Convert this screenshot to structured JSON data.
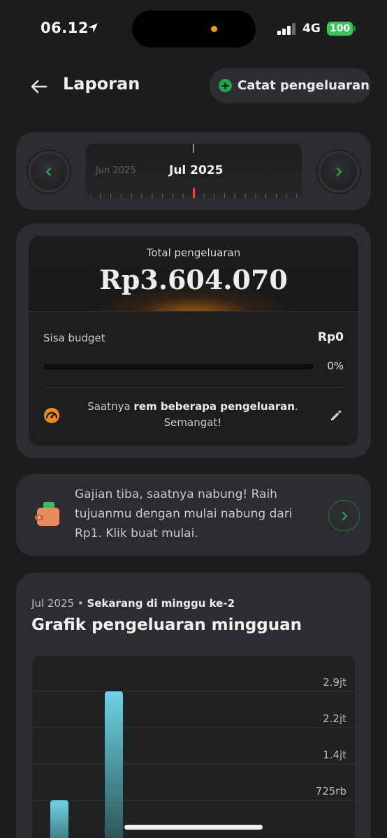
{
  "status": {
    "time": "06.12",
    "network": "4G",
    "battery": "100"
  },
  "header": {
    "title": "Laporan",
    "add_label": "Catat pengeluaran"
  },
  "month": {
    "prev": "Jun 2025",
    "current": "Jul 2025"
  },
  "total": {
    "label": "Total pengeluaran",
    "value": "Rp3.604.070",
    "budget_label": "Sisa budget",
    "budget_value": "Rp0",
    "progress": 0,
    "progress_label": "0%",
    "message_pre": "Saatnya ",
    "message_bold": "rem beberapa pengeluaran",
    "message_post": ". Semangat!"
  },
  "promo": {
    "text": "Gajian tiba, saatnya nabung! Raih tujuanmu dengan mulai nabung dari Rp1. Klik buat mulai."
  },
  "chart": {
    "period": "Jul 2025",
    "separator": " • ",
    "week_note": "Sekarang di minggu ke-2",
    "title": "Grafik pengeluaran mingguan"
  },
  "chart_data": {
    "type": "bar",
    "title": "Grafik pengeluaran mingguan",
    "categories": [
      "",
      ""
    ],
    "values": [
      725000,
      2900000
    ],
    "tick_values": [
      725000,
      1450000,
      2175000,
      2900000
    ],
    "tick_labels": [
      "725rb",
      "1.4jt",
      "2.2jt",
      "2.9jt"
    ],
    "ylim": [
      0,
      2900000
    ],
    "grid": true,
    "colors": {
      "bar_top": "#6dd3e6",
      "bar_bottom": "#1f3a38"
    }
  },
  "colors": {
    "accent_green": "#1ea74a",
    "warning_orange": "#f28a1a",
    "card": "#2b2d30",
    "background": "#1b1c1e"
  }
}
